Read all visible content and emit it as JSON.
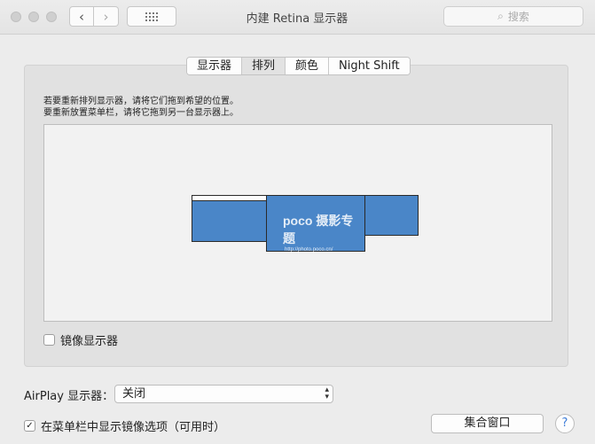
{
  "window": {
    "title": "内建 Retina 显示器"
  },
  "toolbar": {
    "back_icon": "chevron-left-icon",
    "back_glyph": "‹",
    "forward_icon": "chevron-right-icon",
    "forward_glyph": "›",
    "grid_icon": "grid-icon",
    "search_placeholder": "搜索",
    "search_icon_glyph": "⌕"
  },
  "tabs": [
    {
      "label": "显示器",
      "active": false
    },
    {
      "label": "排列",
      "active": true
    },
    {
      "label": "颜色",
      "active": false
    },
    {
      "label": "Night Shift",
      "active": false
    }
  ],
  "arrangement": {
    "instruction_line1": "若要重新排列显示器，请将它们拖到希望的位置。",
    "instruction_line2": "要重新放置菜单栏，请将它拖到另一台显示器上。",
    "watermark_brand": "poco 摄影专题",
    "watermark_url": "http://photo.poco.cn/",
    "display_color": "#4a86c8"
  },
  "mirror_displays": {
    "label": "镜像显示器",
    "checked": false
  },
  "airplay": {
    "label": "AirPlay 显示器：",
    "selected": "关闭"
  },
  "show_mirroring": {
    "label": "在菜单栏中显示镜像选项（可用时）",
    "checked": true,
    "check_glyph": "✓"
  },
  "buttons": {
    "gather_windows": "集合窗口",
    "help": "?"
  }
}
